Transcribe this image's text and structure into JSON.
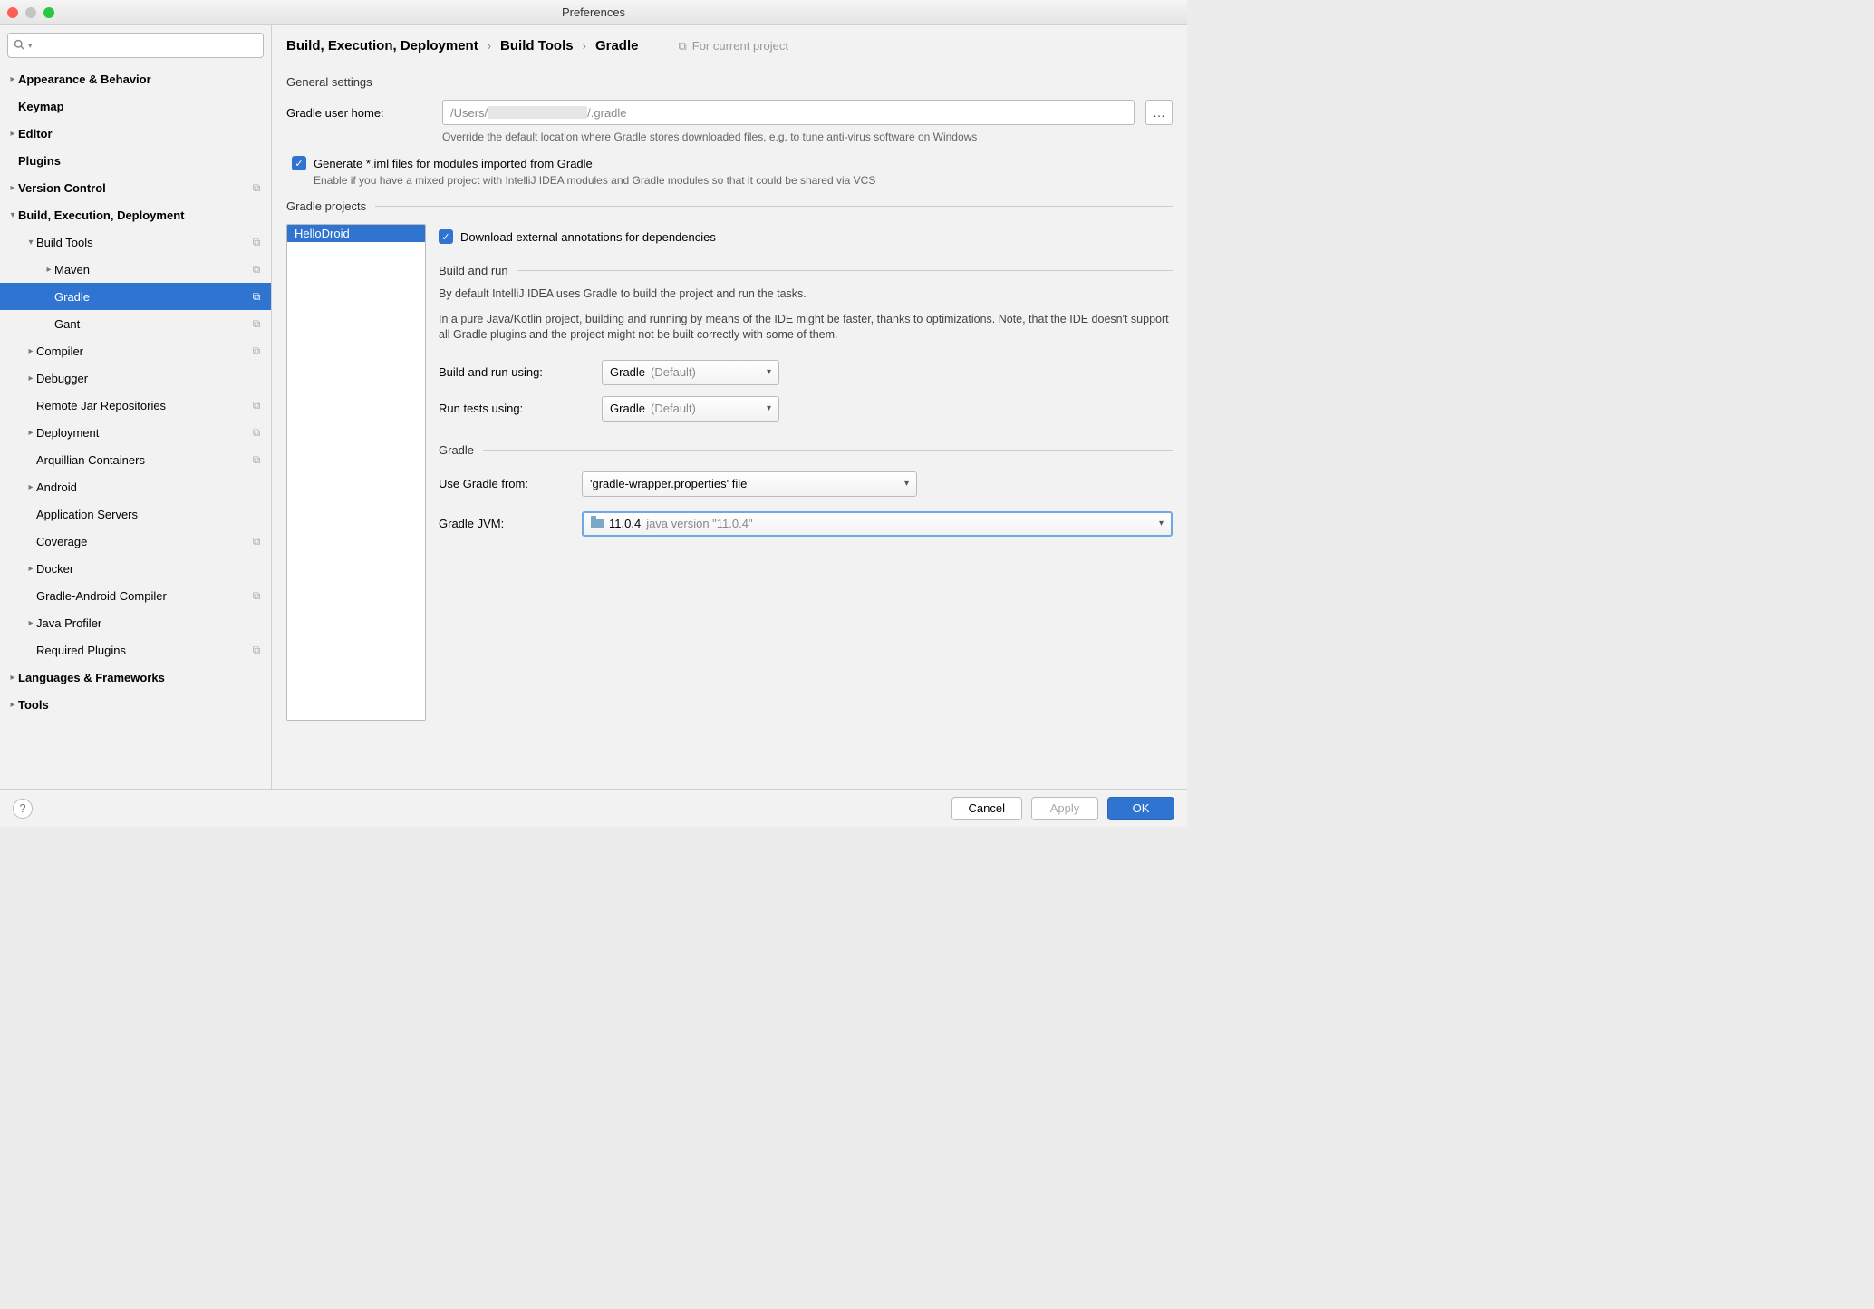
{
  "window": {
    "title": "Preferences"
  },
  "sidebar": {
    "search_placeholder": "",
    "items": [
      {
        "label": "Appearance & Behavior",
        "depth": 0,
        "expandable": true,
        "expanded": false,
        "bold": true
      },
      {
        "label": "Keymap",
        "depth": 0,
        "expandable": false,
        "bold": true
      },
      {
        "label": "Editor",
        "depth": 0,
        "expandable": true,
        "expanded": false,
        "bold": true
      },
      {
        "label": "Plugins",
        "depth": 0,
        "expandable": false,
        "bold": true
      },
      {
        "label": "Version Control",
        "depth": 0,
        "expandable": true,
        "expanded": false,
        "bold": true,
        "copy": true
      },
      {
        "label": "Build, Execution, Deployment",
        "depth": 0,
        "expandable": true,
        "expanded": true,
        "bold": true
      },
      {
        "label": "Build Tools",
        "depth": 1,
        "expandable": true,
        "expanded": true,
        "copy": true
      },
      {
        "label": "Maven",
        "depth": 2,
        "expandable": true,
        "expanded": false,
        "copy": true
      },
      {
        "label": "Gradle",
        "depth": 2,
        "expandable": false,
        "copy": true,
        "selected": true
      },
      {
        "label": "Gant",
        "depth": 2,
        "expandable": false,
        "copy": true
      },
      {
        "label": "Compiler",
        "depth": 1,
        "expandable": true,
        "expanded": false,
        "copy": true
      },
      {
        "label": "Debugger",
        "depth": 1,
        "expandable": true,
        "expanded": false
      },
      {
        "label": "Remote Jar Repositories",
        "depth": 1,
        "expandable": false,
        "copy": true
      },
      {
        "label": "Deployment",
        "depth": 1,
        "expandable": true,
        "expanded": false,
        "copy": true
      },
      {
        "label": "Arquillian Containers",
        "depth": 1,
        "expandable": false,
        "copy": true
      },
      {
        "label": "Android",
        "depth": 1,
        "expandable": true,
        "expanded": false
      },
      {
        "label": "Application Servers",
        "depth": 1,
        "expandable": false
      },
      {
        "label": "Coverage",
        "depth": 1,
        "expandable": false,
        "copy": true
      },
      {
        "label": "Docker",
        "depth": 1,
        "expandable": true,
        "expanded": false
      },
      {
        "label": "Gradle-Android Compiler",
        "depth": 1,
        "expandable": false,
        "copy": true
      },
      {
        "label": "Java Profiler",
        "depth": 1,
        "expandable": true,
        "expanded": false
      },
      {
        "label": "Required Plugins",
        "depth": 1,
        "expandable": false,
        "copy": true
      },
      {
        "label": "Languages & Frameworks",
        "depth": 0,
        "expandable": true,
        "expanded": false,
        "bold": true
      },
      {
        "label": "Tools",
        "depth": 0,
        "expandable": true,
        "expanded": false,
        "bold": true
      }
    ]
  },
  "breadcrumb": {
    "parts": [
      "Build, Execution, Deployment",
      "Build Tools",
      "Gradle"
    ],
    "for_project": "For current project"
  },
  "general": {
    "section_title": "General settings",
    "home_label": "Gradle user home:",
    "home_value_prefix": "/Users/",
    "home_value_suffix": "/.gradle",
    "home_hint": "Override the default location where Gradle stores downloaded files, e.g. to tune anti-virus software on Windows",
    "generate_iml_label": "Generate *.iml files for modules imported from Gradle",
    "generate_iml_hint": "Enable if you have a mixed project with IntelliJ IDEA modules and Gradle modules so that it could be shared via VCS"
  },
  "projects_section": {
    "title": "Gradle projects",
    "items": [
      {
        "label": "HelloDroid",
        "selected": true
      }
    ],
    "download_annotations_label": "Download external annotations for dependencies",
    "build_run": {
      "title": "Build and run",
      "desc1": "By default IntelliJ IDEA uses Gradle to build the project and run the tasks.",
      "desc2": "In a pure Java/Kotlin project, building and running by means of the IDE might be faster, thanks to optimizations. Note, that the IDE doesn't support all Gradle plugins and the project might not be built correctly with some of them.",
      "build_using_label": "Build and run using:",
      "build_using_value": "Gradle",
      "build_using_suffix": "(Default)",
      "tests_using_label": "Run tests using:",
      "tests_using_value": "Gradle",
      "tests_using_suffix": "(Default)"
    },
    "gradle": {
      "title": "Gradle",
      "use_from_label": "Use Gradle from:",
      "use_from_value": "'gradle-wrapper.properties' file",
      "jvm_label": "Gradle JVM:",
      "jvm_version": "11.0.4",
      "jvm_detail": "java version \"11.0.4\""
    }
  },
  "footer": {
    "cancel": "Cancel",
    "apply": "Apply",
    "ok": "OK"
  }
}
